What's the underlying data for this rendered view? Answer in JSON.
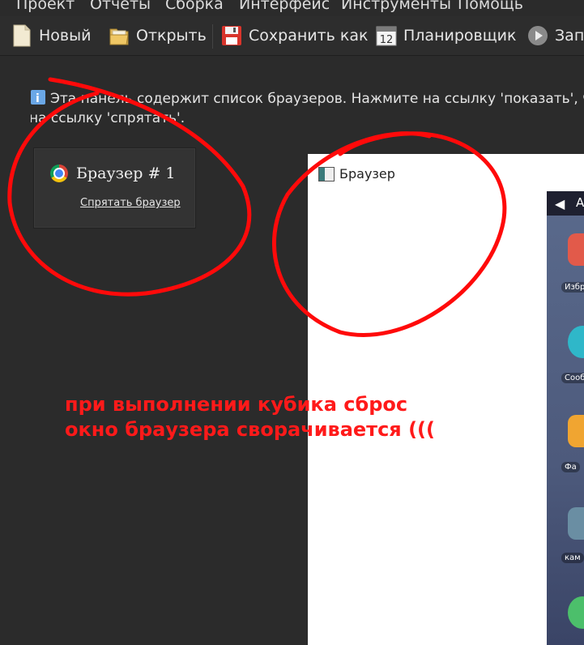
{
  "menu": [
    "Проект",
    "Отчеты",
    "Сборка",
    "Интерфейс",
    "Инструменты",
    "Помощь"
  ],
  "toolbar": {
    "new": "Новый",
    "open": "Открыть",
    "save_as": "Сохранить как",
    "scheduler": "Планировщик",
    "scheduler_icon_text": "12",
    "run": "Запу"
  },
  "info": {
    "line1": "Эта панель содержит список браузеров. Нажмите на ссылку 'показать', ч",
    "line2": "на ссылку 'спрятать'."
  },
  "browser_card": {
    "title": "Браузер # 1",
    "hide_link": "Спрятать браузер"
  },
  "browser_window": {
    "title": "Браузер",
    "phone_apps": [
      "Избр",
      "Сооб",
      "Фа",
      "кам"
    ],
    "phone_top_label": "А"
  },
  "annotation": {
    "line1": "при выполнении кубика сброс",
    "line2": "окно браузера сворачивается (((",
    "color": "#ff1a1a"
  }
}
